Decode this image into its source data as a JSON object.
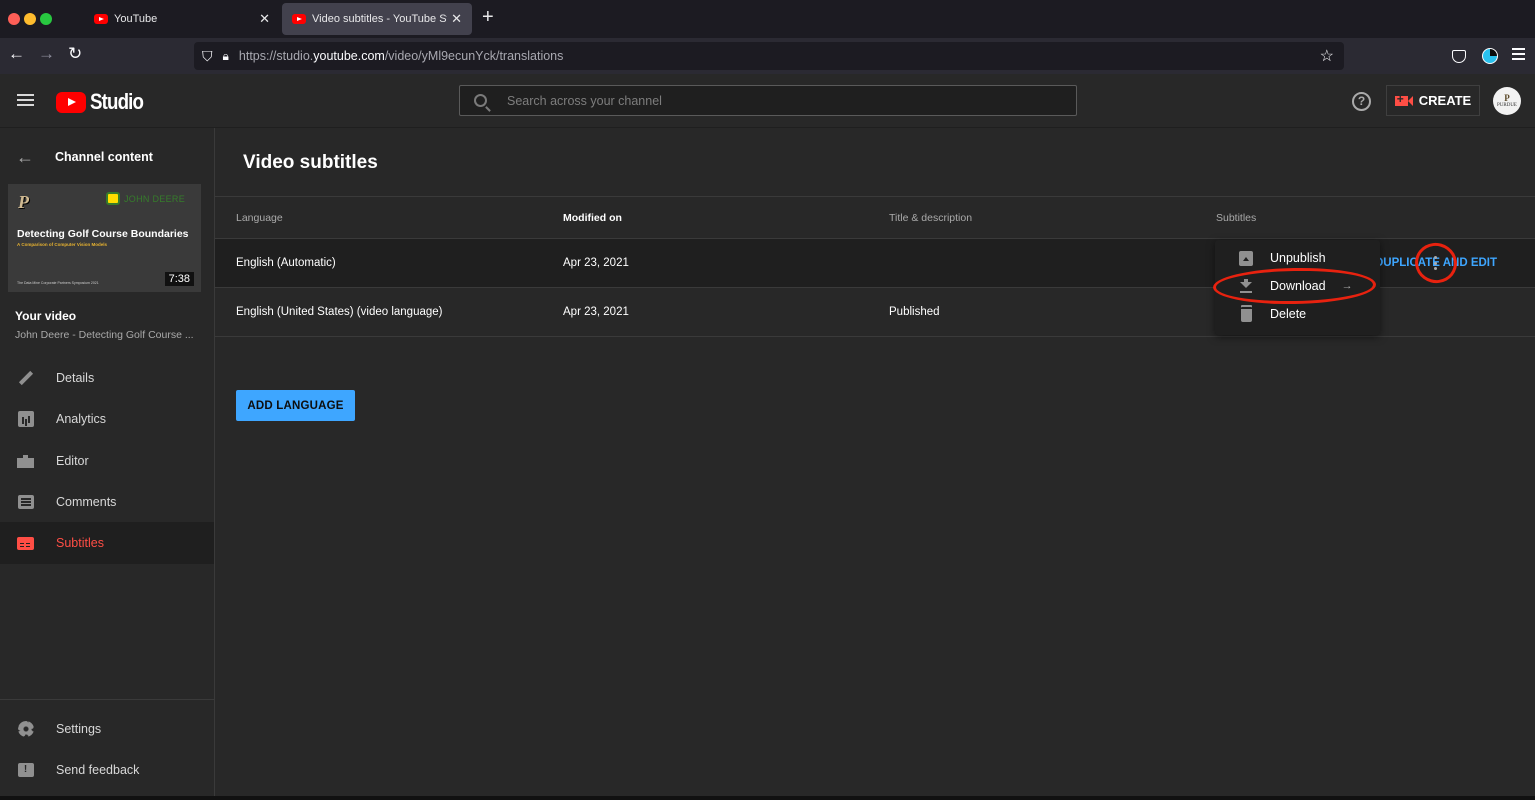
{
  "browser": {
    "tabs": [
      {
        "title": "YouTube",
        "active": false
      },
      {
        "title": "Video subtitles - YouTube Studio",
        "active": true
      }
    ],
    "url": {
      "prefix": "https://studio.",
      "domain": "youtube.com",
      "path": "/video/yMl9ecunYck/translations"
    }
  },
  "header": {
    "logo_text": "Studio",
    "search_placeholder": "Search across your channel",
    "create_label": "CREATE",
    "avatar_text": "P",
    "avatar_subtext": "PURDUE"
  },
  "sidebar": {
    "back_label": "Channel content",
    "thumbnail": {
      "brand_left": "P",
      "brand_right": "JOHN DEERE",
      "title": "Detecting Golf Course Boundaries",
      "subtitle": "A Comparison of Computer Vision Models",
      "footer": "The Data Mine Corporate Partners Symposium 2021",
      "duration": "7:38"
    },
    "your_video_label": "Your video",
    "video_title": "John Deere - Detecting Golf Course ...",
    "items": [
      {
        "label": "Details",
        "icon": "pencil-icon",
        "active": false
      },
      {
        "label": "Analytics",
        "icon": "analytics-icon",
        "active": false
      },
      {
        "label": "Editor",
        "icon": "editor-icon",
        "active": false
      },
      {
        "label": "Comments",
        "icon": "comments-icon",
        "active": false
      },
      {
        "label": "Subtitles",
        "icon": "subtitles-icon",
        "active": true
      }
    ],
    "footer_items": [
      {
        "label": "Settings",
        "icon": "gear-icon"
      },
      {
        "label": "Send feedback",
        "icon": "feedback-icon"
      }
    ]
  },
  "main": {
    "title": "Video subtitles",
    "columns": [
      "Language",
      "Modified on",
      "Title & description",
      "Subtitles"
    ],
    "rows": [
      {
        "language": "English (Automatic)",
        "modified": "Apr 23, 2021",
        "title_desc": "",
        "subtitles": "",
        "action": "DUPLICATE AND EDIT"
      },
      {
        "language": "English (United States) (video language)",
        "modified": "Apr 23, 2021",
        "title_desc": "Published",
        "subtitles": ""
      }
    ],
    "add_language_label": "ADD LANGUAGE"
  },
  "context_menu": {
    "items": [
      {
        "label": "Unpublish",
        "icon": "unpublish-icon"
      },
      {
        "label": "Download",
        "icon": "download-icon",
        "has_submenu": true
      },
      {
        "label": "Delete",
        "icon": "trash-icon"
      }
    ],
    "submenu_arrow": "→"
  },
  "colors": {
    "accent_blue": "#3ea6ff",
    "active_red": "#ff4e45",
    "annotation_red": "#e8220f",
    "background": "#282828"
  }
}
